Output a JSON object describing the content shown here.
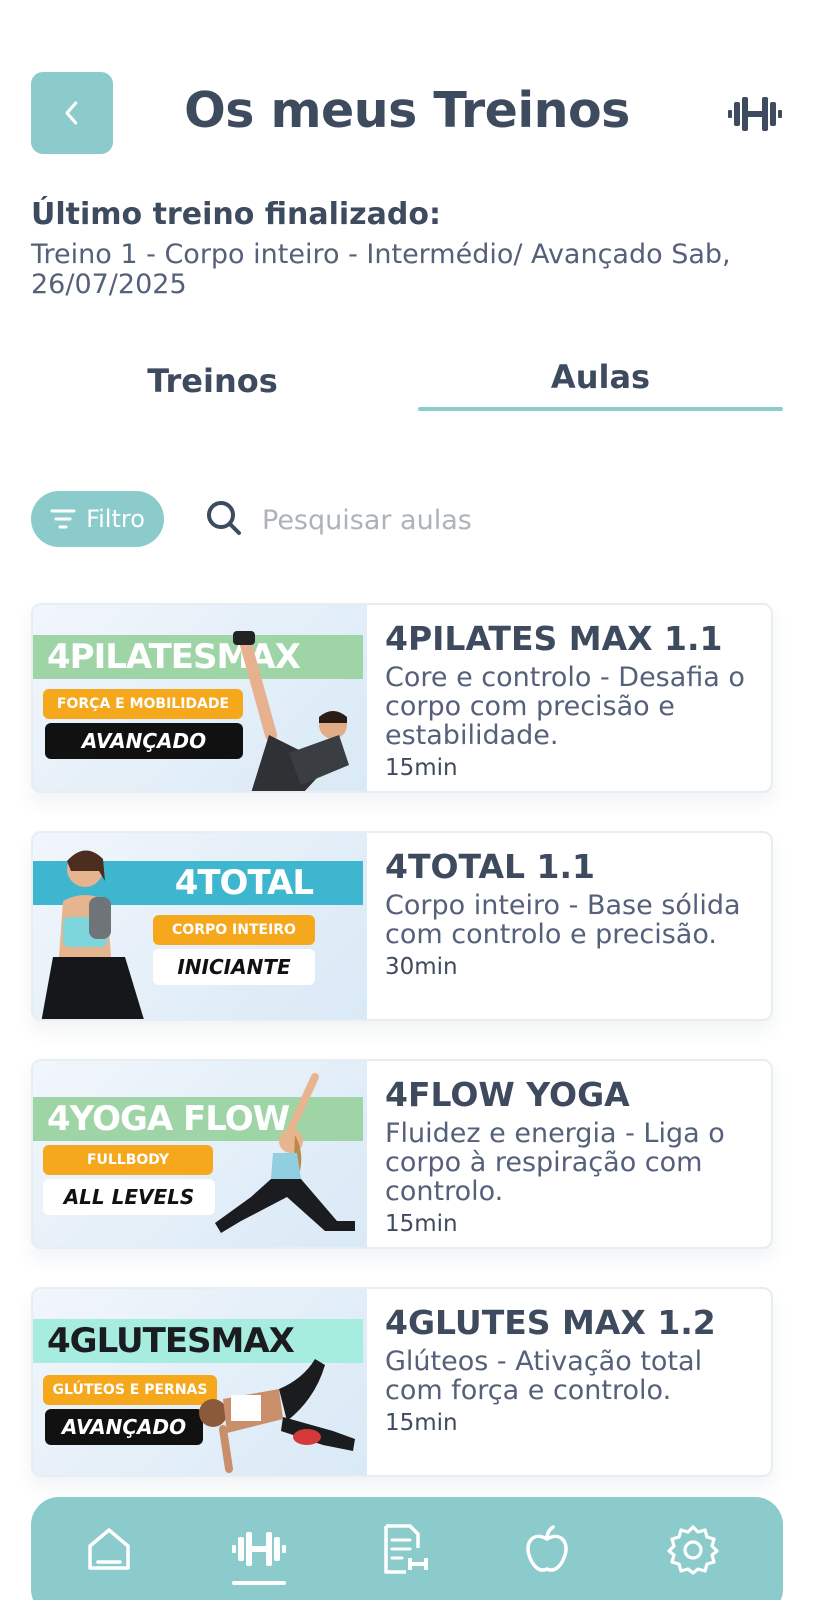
{
  "header": {
    "title": "Os meus Treinos",
    "back_icon": "chevron-left-icon",
    "right_icon": "dumbbell-icon"
  },
  "last_workout": {
    "label": "Último treino finalizado:",
    "value": "Treino 1 - Corpo inteiro - Intermédio/ Avançado Sab, 26/07/2025"
  },
  "tabs": [
    {
      "label": "Treinos",
      "active": false
    },
    {
      "label": "Aulas",
      "active": true
    }
  ],
  "filter": {
    "label": "Filtro",
    "icon": "filter-icon"
  },
  "search": {
    "placeholder": "Pesquisar aulas",
    "value": "",
    "icon": "search-icon"
  },
  "classes": [
    {
      "title": "4PILATES MAX 1.1",
      "description": "Core e controlo - Desafia o corpo com precisão e estabilidade.",
      "duration": "15min",
      "thumb": {
        "banner": "4PILATESMAX",
        "tag": "FORÇA E MOBILIDADE",
        "level": "AVANÇADO",
        "banner_color": "#9fd4a6"
      }
    },
    {
      "title": "4TOTAL 1.1",
      "description": "Corpo inteiro - Base sólida com controlo e precisão.",
      "duration": "30min",
      "thumb": {
        "banner": "4TOTAL",
        "tag": "CORPO INTEIRO",
        "level": "INICIANTE",
        "banner_color": "#3fb6cf"
      }
    },
    {
      "title": "4FLOW YOGA",
      "description": "Fluidez e energia - Liga o corpo à respiração com controlo.",
      "duration": "15min",
      "thumb": {
        "banner": "4YOGA FLOW",
        "tag": "FULLBODY",
        "level": "ALL LEVELS",
        "banner_color": "#9fd4a6"
      }
    },
    {
      "title": "4GLUTES MAX 1.2",
      "description": "Glúteos - Ativação total com força e controlo.",
      "duration": "15min",
      "thumb": {
        "banner": "4GLUTESMAX",
        "tag": "GLÚTEOS E PERNAS",
        "level": "AVANÇADO",
        "banner_color": "#a6ecdf"
      }
    }
  ],
  "bottom_nav": [
    {
      "icon": "home-icon",
      "active": false
    },
    {
      "icon": "dumbbell-icon",
      "active": true
    },
    {
      "icon": "plan-list-icon",
      "active": false
    },
    {
      "icon": "apple-icon",
      "active": false
    },
    {
      "icon": "settings-gear-icon",
      "active": false
    }
  ],
  "colors": {
    "accent": "#8ccbcb",
    "text": "#3e4a5e",
    "orange": "#f6a81d"
  }
}
